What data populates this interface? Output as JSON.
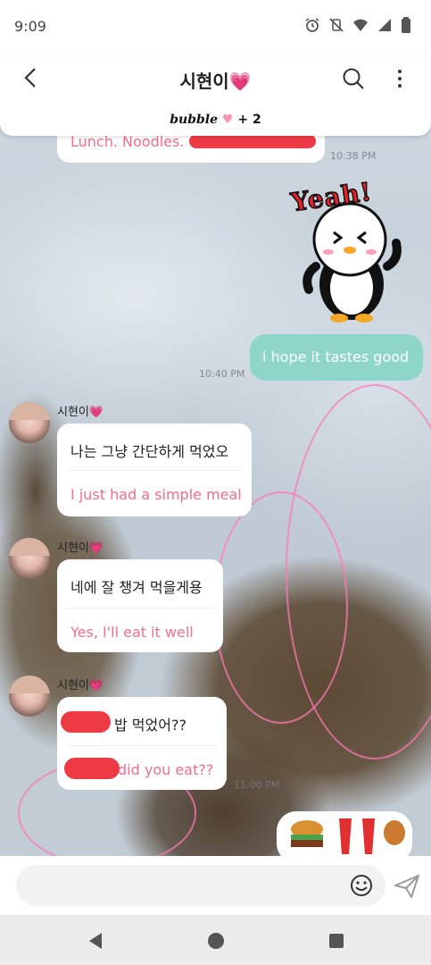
{
  "status_bar": {
    "time": "9:09"
  },
  "header": {
    "contact_name": "시현이",
    "contact_emoji": "💗",
    "bubble_logo": "bubble",
    "bubble_plus": "+ 2"
  },
  "messages": [
    {
      "type": "received_partial",
      "text": "Lunch. Noodles.",
      "time": "10:38 PM"
    },
    {
      "type": "sticker",
      "sticker_text": "Yeah!"
    },
    {
      "type": "sent",
      "text": "i hope it tastes good",
      "time": "10:40 PM"
    },
    {
      "type": "received",
      "sender": "시현이",
      "sender_emoji": "💗",
      "korean": "나는 그냥 간단하게 먹었오",
      "english": "I just had a simple meal"
    },
    {
      "type": "received",
      "sender": "시현이",
      "sender_emoji": "💗",
      "korean": "네에 잘 챙겨 먹을게용",
      "english": "Yes, I'll eat it well"
    },
    {
      "type": "received",
      "sender": "시현이",
      "sender_emoji": "💗",
      "korean": "밥 먹었어??",
      "english": "did you eat??",
      "time": "11:00 PM"
    }
  ],
  "input": {
    "placeholder": ""
  },
  "colors": {
    "accent_pink": "#f26d8f",
    "sent_bubble": "#8ed6c7",
    "redaction": "#ee3a45"
  }
}
